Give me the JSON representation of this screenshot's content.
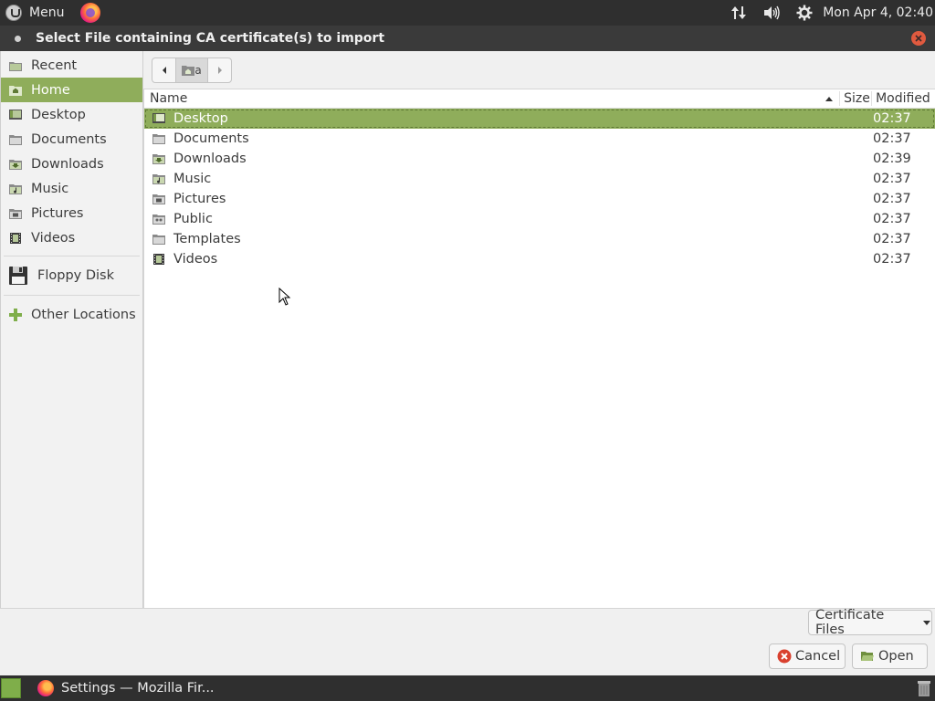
{
  "top_panel": {
    "menu_label": "Menu",
    "clock": "Mon Apr  4, 02:40"
  },
  "dialog": {
    "title": "Select File containing CA certificate(s) to import"
  },
  "sidebar": {
    "items": [
      {
        "label": "Recent",
        "icon": "recent-icon"
      },
      {
        "label": "Home",
        "icon": "home-folder-icon",
        "active": true
      },
      {
        "label": "Desktop",
        "icon": "desktop-icon"
      },
      {
        "label": "Documents",
        "icon": "documents-folder-icon"
      },
      {
        "label": "Downloads",
        "icon": "downloads-folder-icon"
      },
      {
        "label": "Music",
        "icon": "music-folder-icon"
      },
      {
        "label": "Pictures",
        "icon": "pictures-folder-icon"
      },
      {
        "label": "Videos",
        "icon": "videos-folder-icon"
      }
    ],
    "devices": [
      {
        "label": "Floppy Disk",
        "icon": "floppy-disk-icon"
      }
    ],
    "other": {
      "label": "Other Locations",
      "icon": "plus-icon"
    }
  },
  "pathbar": {
    "crumb_label": "a"
  },
  "filelist": {
    "columns": {
      "name": "Name",
      "size": "Size",
      "modified": "Modified"
    },
    "rows": [
      {
        "name": "Desktop",
        "modified": "02:37",
        "selected": true
      },
      {
        "name": "Documents",
        "modified": "02:37"
      },
      {
        "name": "Downloads",
        "modified": "02:39"
      },
      {
        "name": "Music",
        "modified": "02:37"
      },
      {
        "name": "Pictures",
        "modified": "02:37"
      },
      {
        "name": "Public",
        "modified": "02:37"
      },
      {
        "name": "Templates",
        "modified": "02:37"
      },
      {
        "name": "Videos",
        "modified": "02:37"
      }
    ]
  },
  "bottom": {
    "filter_label": "Certificate Files",
    "cancel_label": "Cancel",
    "open_label": "Open"
  },
  "taskbar": {
    "task_label": "Settings — Mozilla Fir..."
  },
  "colors": {
    "accent": "#8fad5b",
    "panel": "#2f2f2f"
  }
}
